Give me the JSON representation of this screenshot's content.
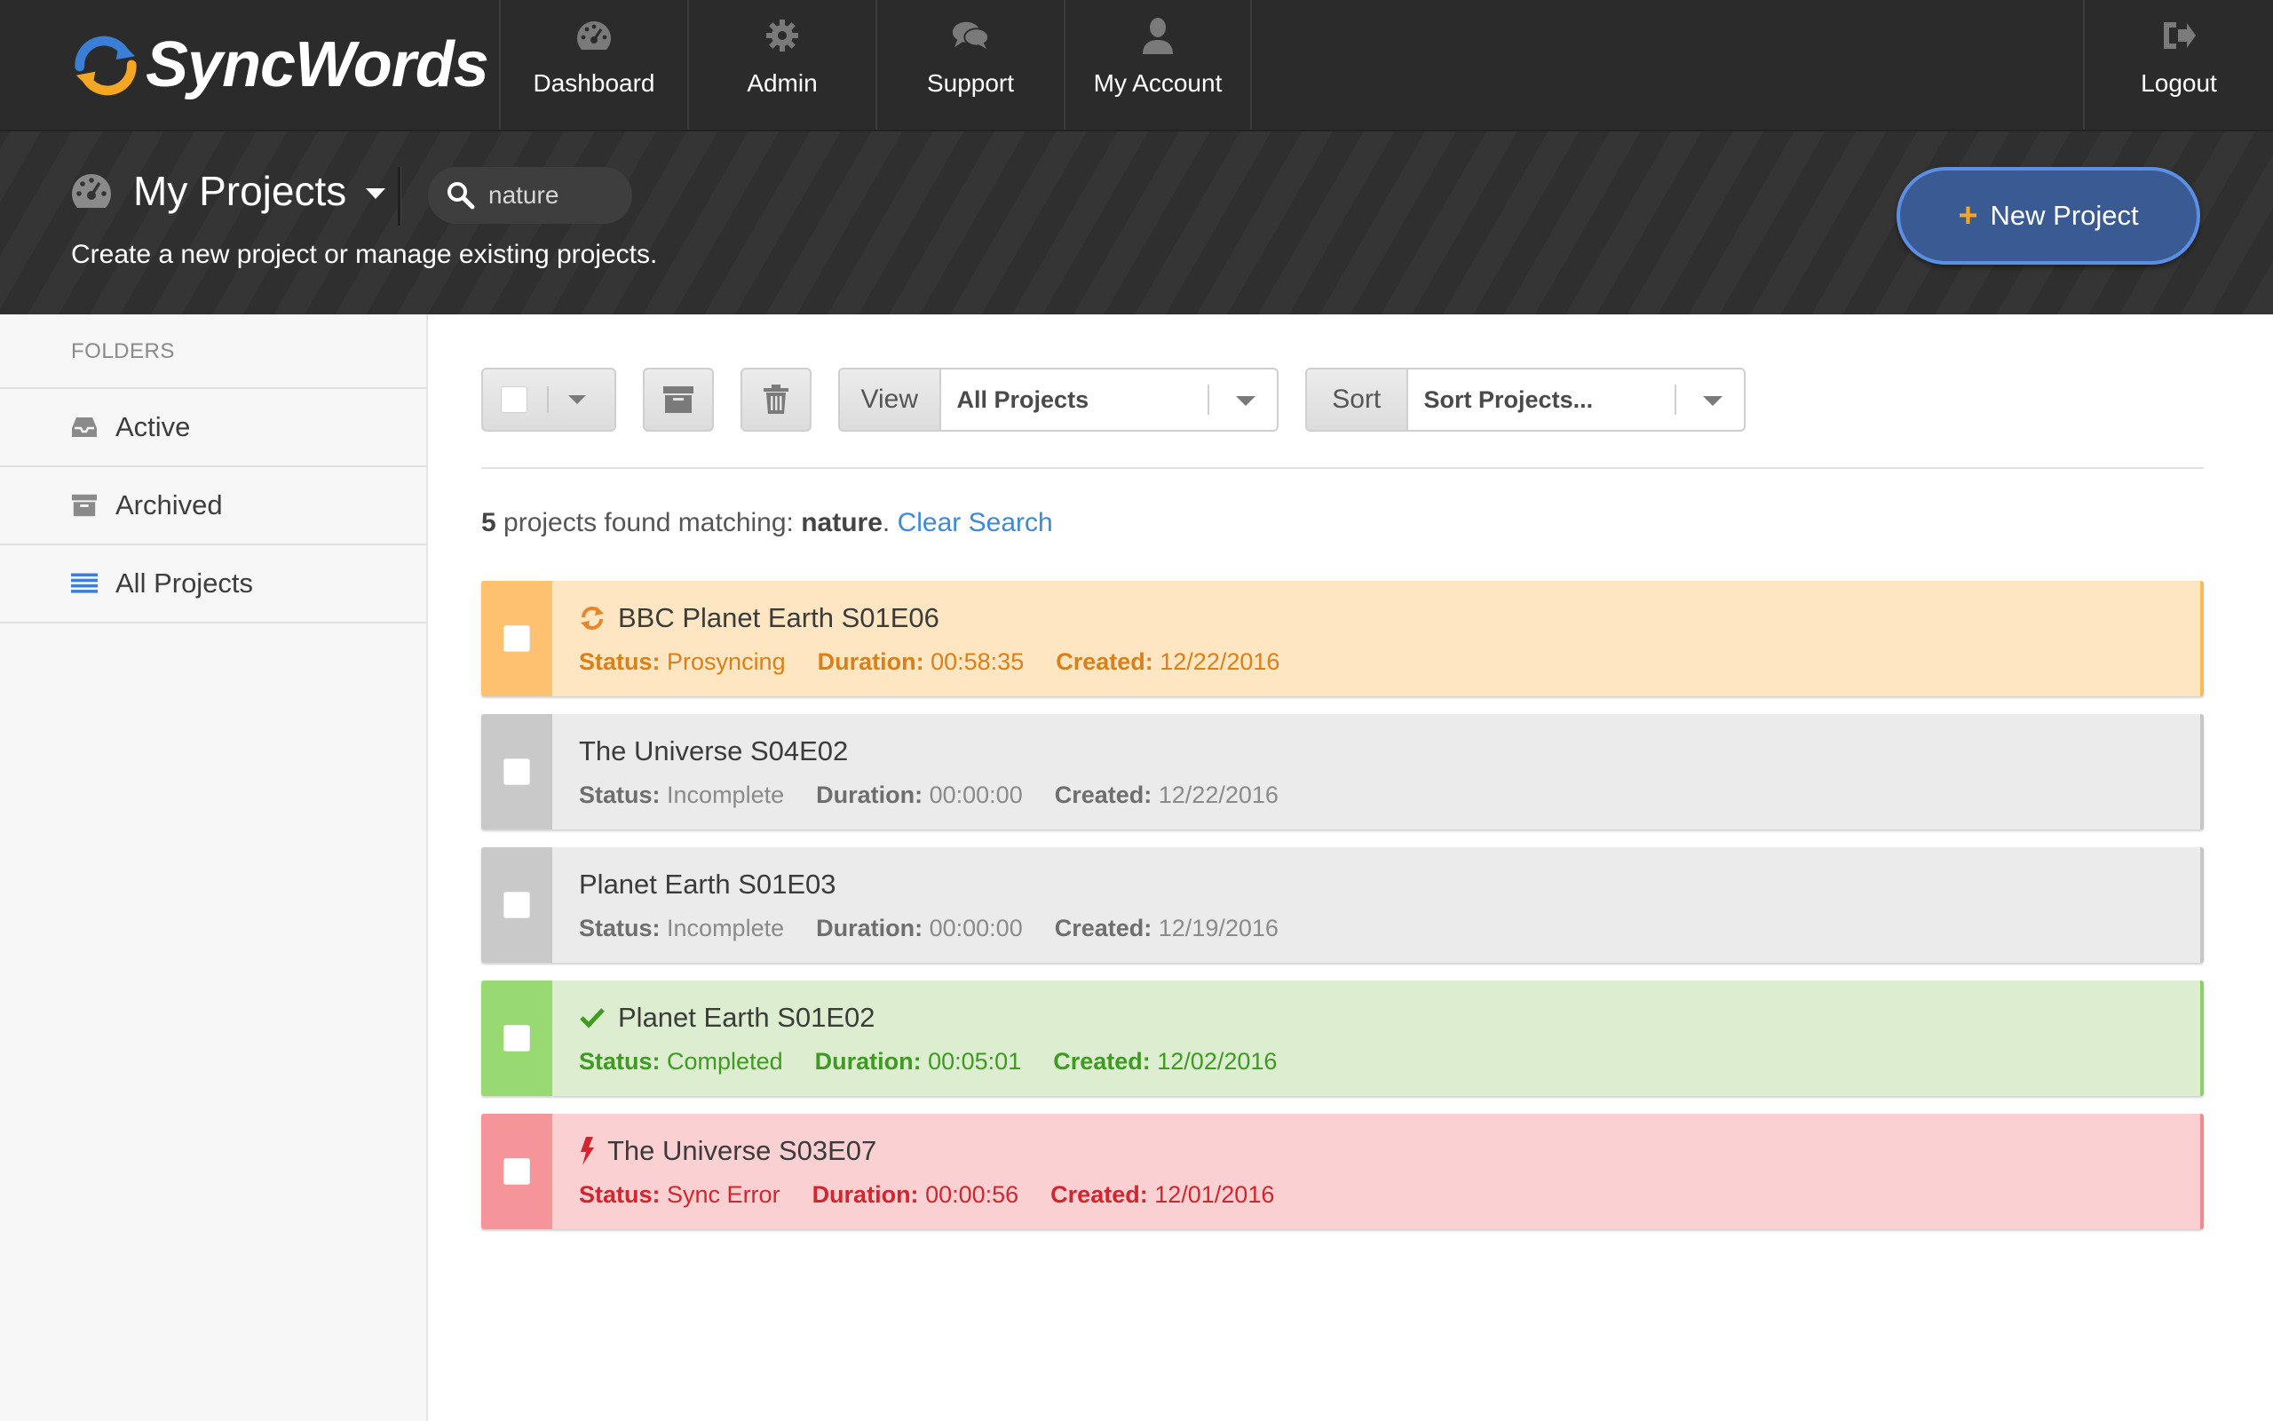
{
  "brand": {
    "name": "SyncWords"
  },
  "nav": {
    "items": [
      {
        "label": "Dashboard",
        "icon": "dashboard-icon"
      },
      {
        "label": "Admin",
        "icon": "gear-icon"
      },
      {
        "label": "Support",
        "icon": "chat-icon"
      },
      {
        "label": "My Account",
        "icon": "user-icon"
      }
    ],
    "logout": {
      "label": "Logout",
      "icon": "logout-icon"
    }
  },
  "header": {
    "title": "My Projects",
    "subtitle": "Create a new project or manage existing projects.",
    "search_value": "nature",
    "new_project_label": "New Project"
  },
  "sidebar": {
    "heading": "FOLDERS",
    "items": [
      {
        "label": "Active",
        "icon": "inbox-icon"
      },
      {
        "label": "Archived",
        "icon": "archive-icon"
      },
      {
        "label": "All Projects",
        "icon": "list-icon",
        "selected": true
      }
    ]
  },
  "toolbar": {
    "view_label": "View",
    "view_value": "All Projects",
    "sort_label": "Sort",
    "sort_value": "Sort Projects..."
  },
  "results": {
    "count": "5",
    "text": " projects found matching: ",
    "query": "nature",
    "period": ".",
    "clear_label": "Clear Search"
  },
  "labels": {
    "status": "Status:",
    "duration": "Duration:",
    "created": "Created:"
  },
  "projects": [
    {
      "name": "BBC Planet Earth S01E06",
      "status": "Prosyncing",
      "duration": "00:58:35",
      "created": "12/22/2016",
      "state": "orange",
      "icon": "sync-icon"
    },
    {
      "name": "The Universe S04E02",
      "status": "Incomplete",
      "duration": "00:00:00",
      "created": "12/22/2016",
      "state": "gray",
      "icon": ""
    },
    {
      "name": "Planet Earth S01E03",
      "status": "Incomplete",
      "duration": "00:00:00",
      "created": "12/19/2016",
      "state": "gray",
      "icon": ""
    },
    {
      "name": "Planet Earth S01E02",
      "status": "Completed",
      "duration": "00:05:01",
      "created": "12/02/2016",
      "state": "green",
      "icon": "checkmark-icon"
    },
    {
      "name": "The Universe S03E07",
      "status": "Sync Error",
      "duration": "00:00:56",
      "created": "12/01/2016",
      "state": "red",
      "icon": "bolt-icon"
    }
  ],
  "colors": {
    "nav_bg": "#2b2b2b",
    "accent_blue": "#3a5a93",
    "link_blue": "#3d8ad6",
    "orange": "#d8801a",
    "green": "#3e9b21",
    "red": "#d1262e"
  }
}
